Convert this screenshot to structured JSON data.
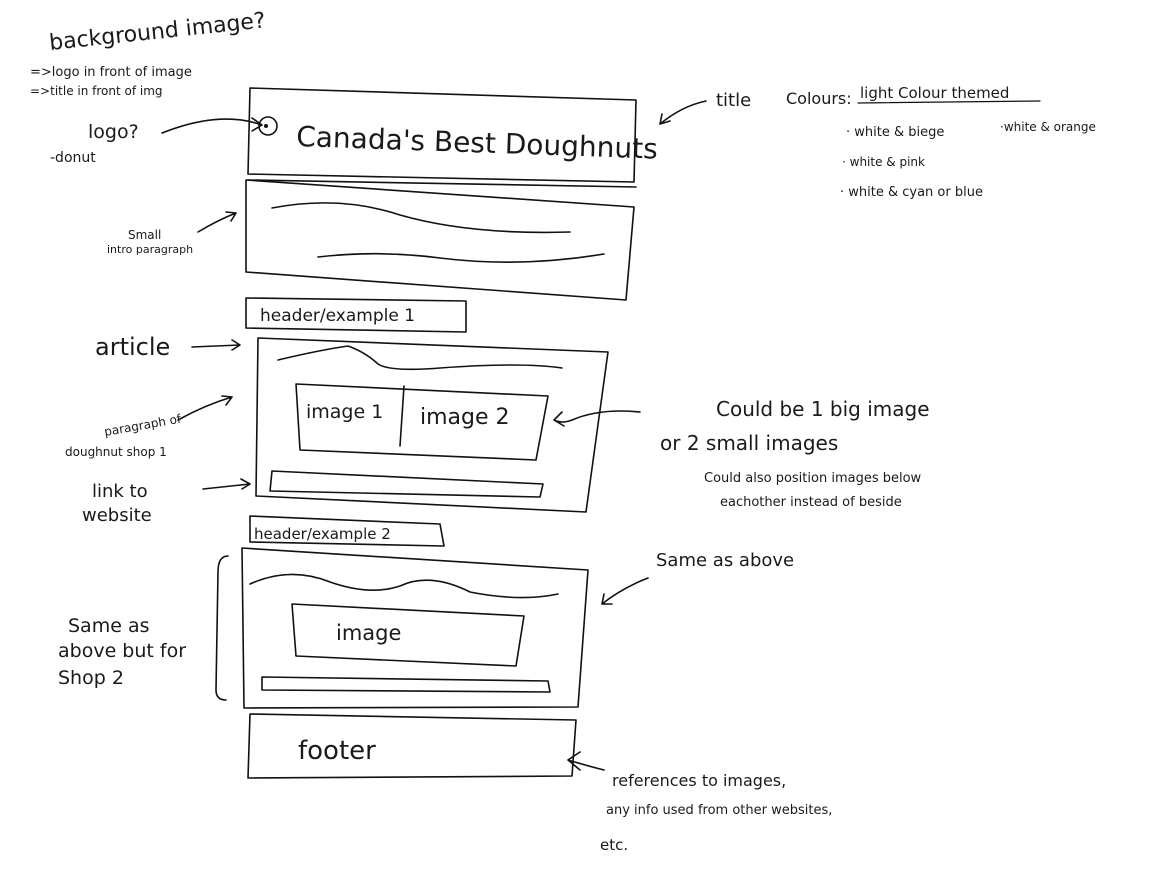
{
  "annotations": {
    "background_note": "background image?",
    "logo_in_front": "=>logo in front of image",
    "title_in_front": "=>title in front of img",
    "logo_q": "logo?",
    "logo_donut": "-donut",
    "small_intro": "Small",
    "intro_paragraph": "intro paragraph",
    "article": "article",
    "paragraph_of": "paragraph of",
    "doughnut_shop_1": "doughnut shop 1",
    "link_to": "link to",
    "website": "website",
    "same_as_1": "Same as",
    "same_as_2": "above but for",
    "same_as_3": "Shop 2",
    "title_label": "title",
    "colours": "Colours:",
    "light_colour_themed": "light Colour themed",
    "colour_1": "· white & biege",
    "colour_2": "· white & pink",
    "colour_3": "· white & cyan or blue",
    "colour_4": "·white & orange",
    "big_image_1": "Could be 1 big image",
    "big_image_2": "or 2 small images",
    "position_1": "Could also position images below",
    "position_2": "eachother instead of beside",
    "same_as_above": "Same as above",
    "refs_1": "references to images,",
    "refs_2": "any info used from other websites,",
    "refs_3": "etc."
  },
  "wireframe": {
    "site_title": "Canada's Best Doughnuts",
    "header_1": "header/example 1",
    "image_1": "image 1",
    "image_2": "image 2",
    "header_2": "header/example 2",
    "image_single": "image",
    "footer": "footer"
  }
}
